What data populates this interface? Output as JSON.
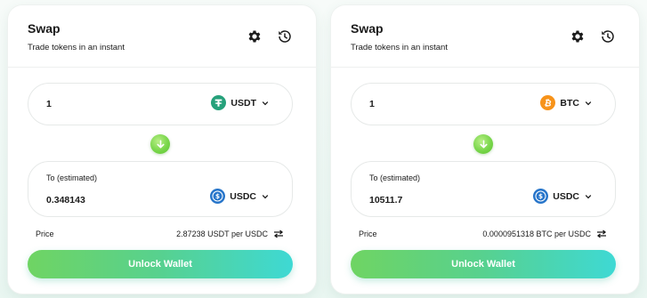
{
  "panels": [
    {
      "title": "Swap",
      "subtitle": "Trade tokens in an instant",
      "header_icons": [
        "settings-gear-icon",
        "history-icon"
      ],
      "from": {
        "amount": "1",
        "token": "USDT",
        "token_icon": "usdt-icon",
        "token_color": "#26A17B"
      },
      "to": {
        "label": "To (estimated)",
        "amount": "0.348143",
        "token": "USDC",
        "token_icon": "usdc-icon",
        "token_color": "#2775CA"
      },
      "price": {
        "label": "Price",
        "value": "2.87238 USDT per USDC"
      },
      "action": "Unlock Wallet"
    },
    {
      "title": "Swap",
      "subtitle": "Trade tokens in an instant",
      "header_icons": [
        "settings-gear-icon",
        "history-icon"
      ],
      "from": {
        "amount": "1",
        "token": "BTC",
        "token_icon": "btc-icon",
        "token_color": "#F7931A"
      },
      "to": {
        "label": "To (estimated)",
        "amount": "10511.7",
        "token": "USDC",
        "token_icon": "usdc-icon",
        "token_color": "#2775CA"
      },
      "price": {
        "label": "Price",
        "value": "0.0000951318 BTC per USDC"
      },
      "action": "Unlock Wallet"
    }
  ],
  "colors": {
    "accent_green": "#79d64b",
    "button_gradient_start": "#6fd463",
    "button_gradient_end": "#3ed9d4",
    "text": "#1b1b1b"
  }
}
